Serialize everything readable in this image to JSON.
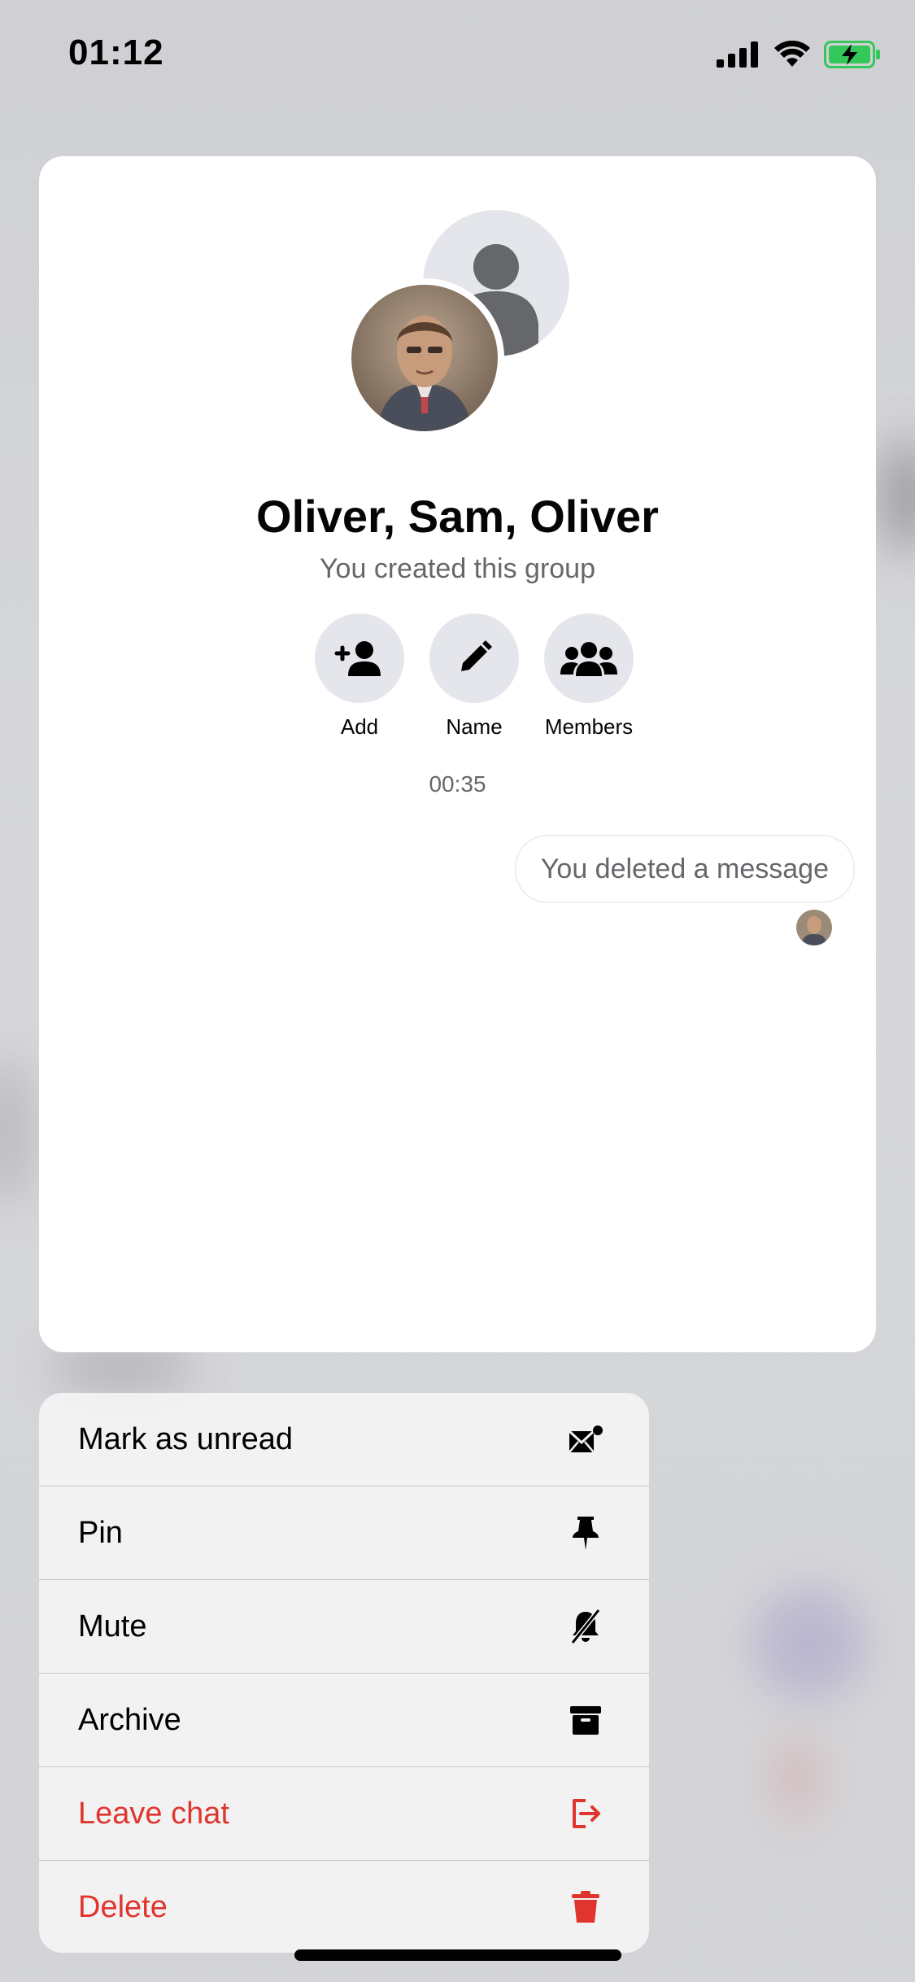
{
  "status_bar": {
    "time": "01:12"
  },
  "group": {
    "title": "Oliver, Sam, Oliver",
    "subtitle": "You created this group"
  },
  "actions": [
    {
      "label": "Add",
      "icon": "add-person-icon"
    },
    {
      "label": "Name",
      "icon": "pencil-icon"
    },
    {
      "label": "Members",
      "icon": "group-icon"
    }
  ],
  "chat": {
    "timestamp": "00:35",
    "deleted_message": "You deleted a message"
  },
  "menu": {
    "items": [
      {
        "label": "Mark as unread",
        "icon": "envelope-dot-icon",
        "color": "#000000"
      },
      {
        "label": "Pin",
        "icon": "pin-icon",
        "color": "#000000"
      },
      {
        "label": "Mute",
        "icon": "bell-slash-icon",
        "color": "#000000"
      },
      {
        "label": "Archive",
        "icon": "archive-box-icon",
        "color": "#000000"
      },
      {
        "label": "Leave chat",
        "icon": "leave-arrow-icon",
        "color": "#e0352f"
      },
      {
        "label": "Delete",
        "icon": "trash-icon",
        "color": "#e0352f"
      }
    ]
  },
  "colors": {
    "danger": "#e0352f",
    "secondary_text": "#65676b",
    "action_circle": "#e4e6eb",
    "battery_charging": "#34c759"
  }
}
